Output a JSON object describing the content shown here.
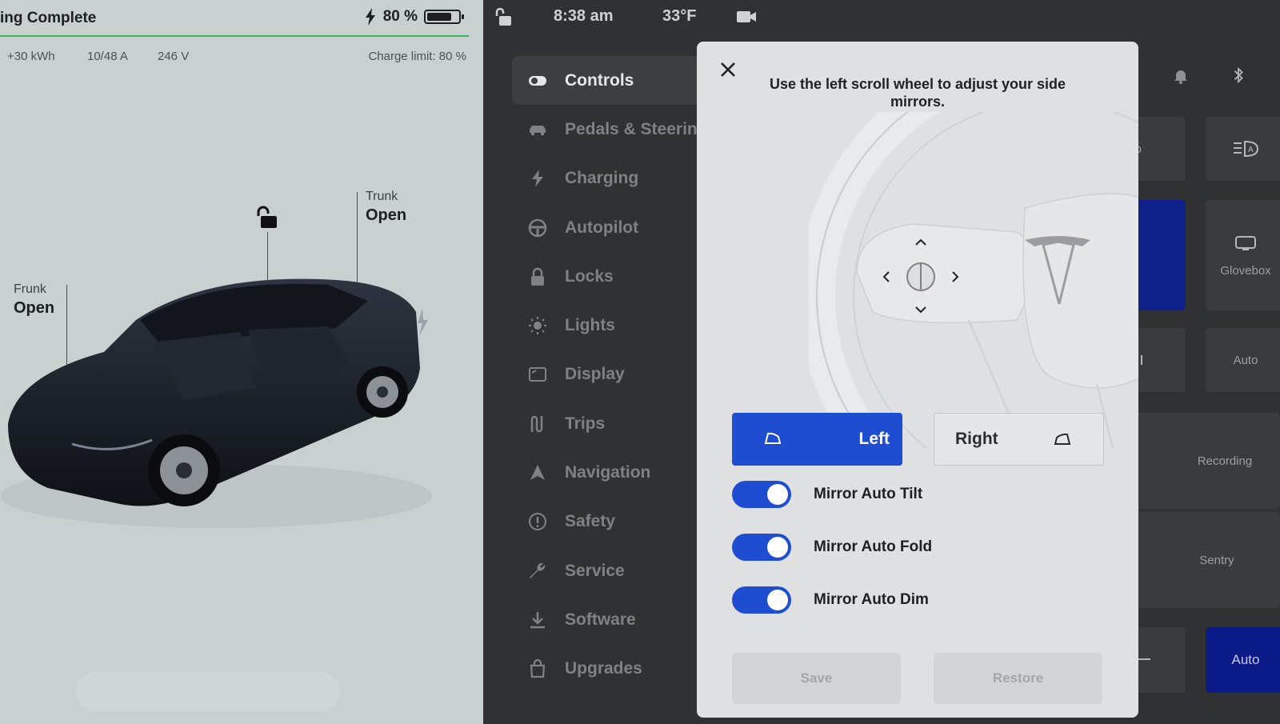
{
  "car_panel": {
    "status_title": "ing Complete",
    "battery_percent": "80 %",
    "battery_level": 0.8,
    "stats": {
      "energy": "+30 kWh",
      "current": "10/48 A",
      "voltage": "246 V",
      "charge_limit": "Charge limit: 80 %"
    },
    "trunk": {
      "caption": "Trunk",
      "state": "Open"
    },
    "frunk": {
      "caption": "Frunk",
      "state": "Open"
    }
  },
  "topbar": {
    "time": "8:38 am",
    "temperature": "33°F"
  },
  "menu": {
    "items": [
      {
        "label": "Controls",
        "icon": "toggle-icon"
      },
      {
        "label": "Pedals & Steering",
        "icon": "car-icon"
      },
      {
        "label": "Charging",
        "icon": "bolt-icon"
      },
      {
        "label": "Autopilot",
        "icon": "steering-wheel-icon"
      },
      {
        "label": "Locks",
        "icon": "lock-icon"
      },
      {
        "label": "Lights",
        "icon": "sun-icon"
      },
      {
        "label": "Display",
        "icon": "display-icon"
      },
      {
        "label": "Trips",
        "icon": "trips-icon"
      },
      {
        "label": "Navigation",
        "icon": "navigation-icon"
      },
      {
        "label": "Safety",
        "icon": "alert-icon"
      },
      {
        "label": "Service",
        "icon": "wrench-icon"
      },
      {
        "label": "Software",
        "icon": "download-icon"
      },
      {
        "label": "Upgrades",
        "icon": "bag-icon"
      }
    ]
  },
  "tiles": {
    "auto1": "uto",
    "glovebox": "Glovebox",
    "auto2": "Auto",
    "recording": "Recording",
    "sentry": "Sentry",
    "auto3": "Auto",
    "partial_w": "w"
  },
  "modal": {
    "instruction": "Use the left scroll wheel to adjust your side mirrors.",
    "left_label": "Left",
    "right_label": "Right",
    "toggles": [
      {
        "label": "Mirror Auto Tilt",
        "on": true
      },
      {
        "label": "Mirror Auto Fold",
        "on": true
      },
      {
        "label": "Mirror Auto Dim",
        "on": true
      }
    ],
    "save_label": "Save",
    "restore_label": "Restore"
  },
  "colors": {
    "accent_blue": "#1f4dd1",
    "charge_green": "#3cb35a",
    "panel_bg": "#c9d0d0",
    "modal_bg": "#dee0e2"
  }
}
